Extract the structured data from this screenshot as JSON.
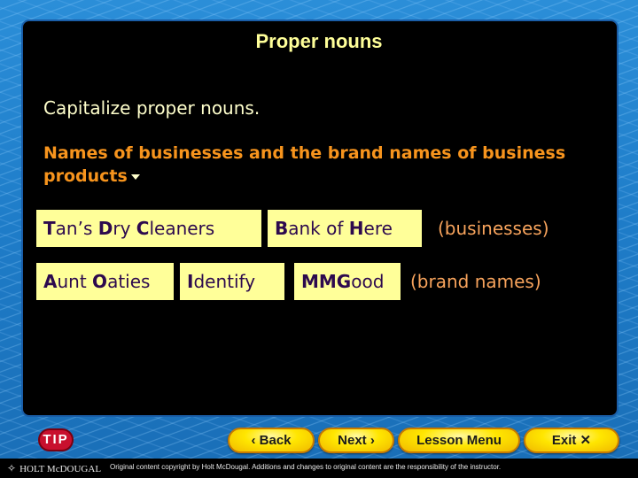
{
  "slide": {
    "title": "Proper nouns",
    "rule": "Capitalize proper nouns.",
    "subheading": "Names of businesses and the brand names of business products"
  },
  "rows": [
    {
      "items": [
        {
          "parts": [
            {
              "t": "T",
              "b": true
            },
            {
              "t": "an’s ",
              "b": false
            },
            {
              "t": "D",
              "b": true
            },
            {
              "t": "ry ",
              "b": false
            },
            {
              "t": "C",
              "b": true
            },
            {
              "t": "leaners",
              "b": false
            }
          ]
        },
        {
          "parts": [
            {
              "t": "B",
              "b": true
            },
            {
              "t": "ank of ",
              "b": false
            },
            {
              "t": "H",
              "b": true
            },
            {
              "t": "ere",
              "b": false
            }
          ]
        }
      ],
      "note": "(businesses)"
    },
    {
      "items": [
        {
          "parts": [
            {
              "t": "A",
              "b": true
            },
            {
              "t": "unt ",
              "b": false
            },
            {
              "t": "O",
              "b": true
            },
            {
              "t": "aties",
              "b": false
            }
          ]
        },
        {
          "parts": [
            {
              "t": "I",
              "b": true
            },
            {
              "t": "dentify",
              "b": false
            }
          ]
        },
        {
          "parts": [
            {
              "t": "MMG",
              "b": true
            },
            {
              "t": "ood",
              "b": false
            }
          ]
        }
      ],
      "note": "(brand names)"
    }
  ],
  "nav": {
    "tip": "TIP",
    "back": "‹ Back",
    "next": "Next ›",
    "lesson_menu": "Lesson Menu",
    "exit": "Exit ✕"
  },
  "footer": {
    "logo": "HOLT McDOUGAL",
    "logo_icon": "dolphin-icon",
    "copyright": "Original content copyright by Holt McDougal. Additions and changes to original content are the responsibility of the instructor."
  },
  "colors": {
    "title": "#ffff99",
    "subheading": "#f7941d",
    "box_bg": "#ffff99",
    "box_text": "#2d0a4e",
    "note": "#f7a35c"
  }
}
